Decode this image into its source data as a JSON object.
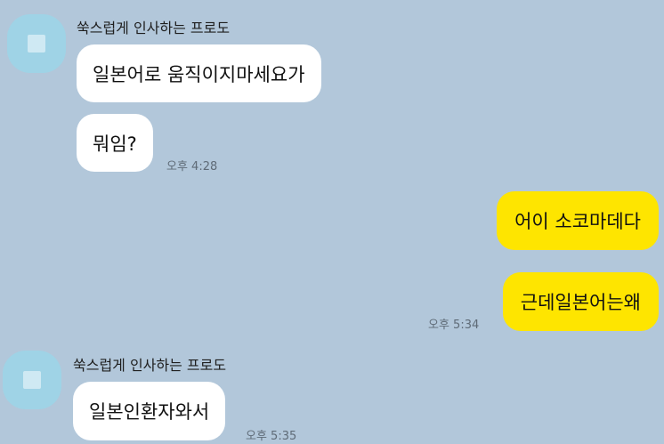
{
  "theme": {
    "background": "#b2c7da",
    "incoming_bubble": "#ffffff",
    "outgoing_bubble": "#fee500",
    "avatar": "#9fd3e6"
  },
  "messages": {
    "group1": {
      "sender": "쑥스럽게 인사하는 프로도",
      "msg1": "일본어로 움직이지마세요가",
      "msg2": "뭐임?",
      "time": "오후 4:28"
    },
    "group2": {
      "msg1": "어이 소코마데다",
      "msg2": "근데일본어는왜",
      "time": "오후 5:34"
    },
    "group3": {
      "sender": "쑥스럽게 인사하는 프로도",
      "msg1": "일본인환자와서",
      "time": "오후 5:35"
    }
  }
}
